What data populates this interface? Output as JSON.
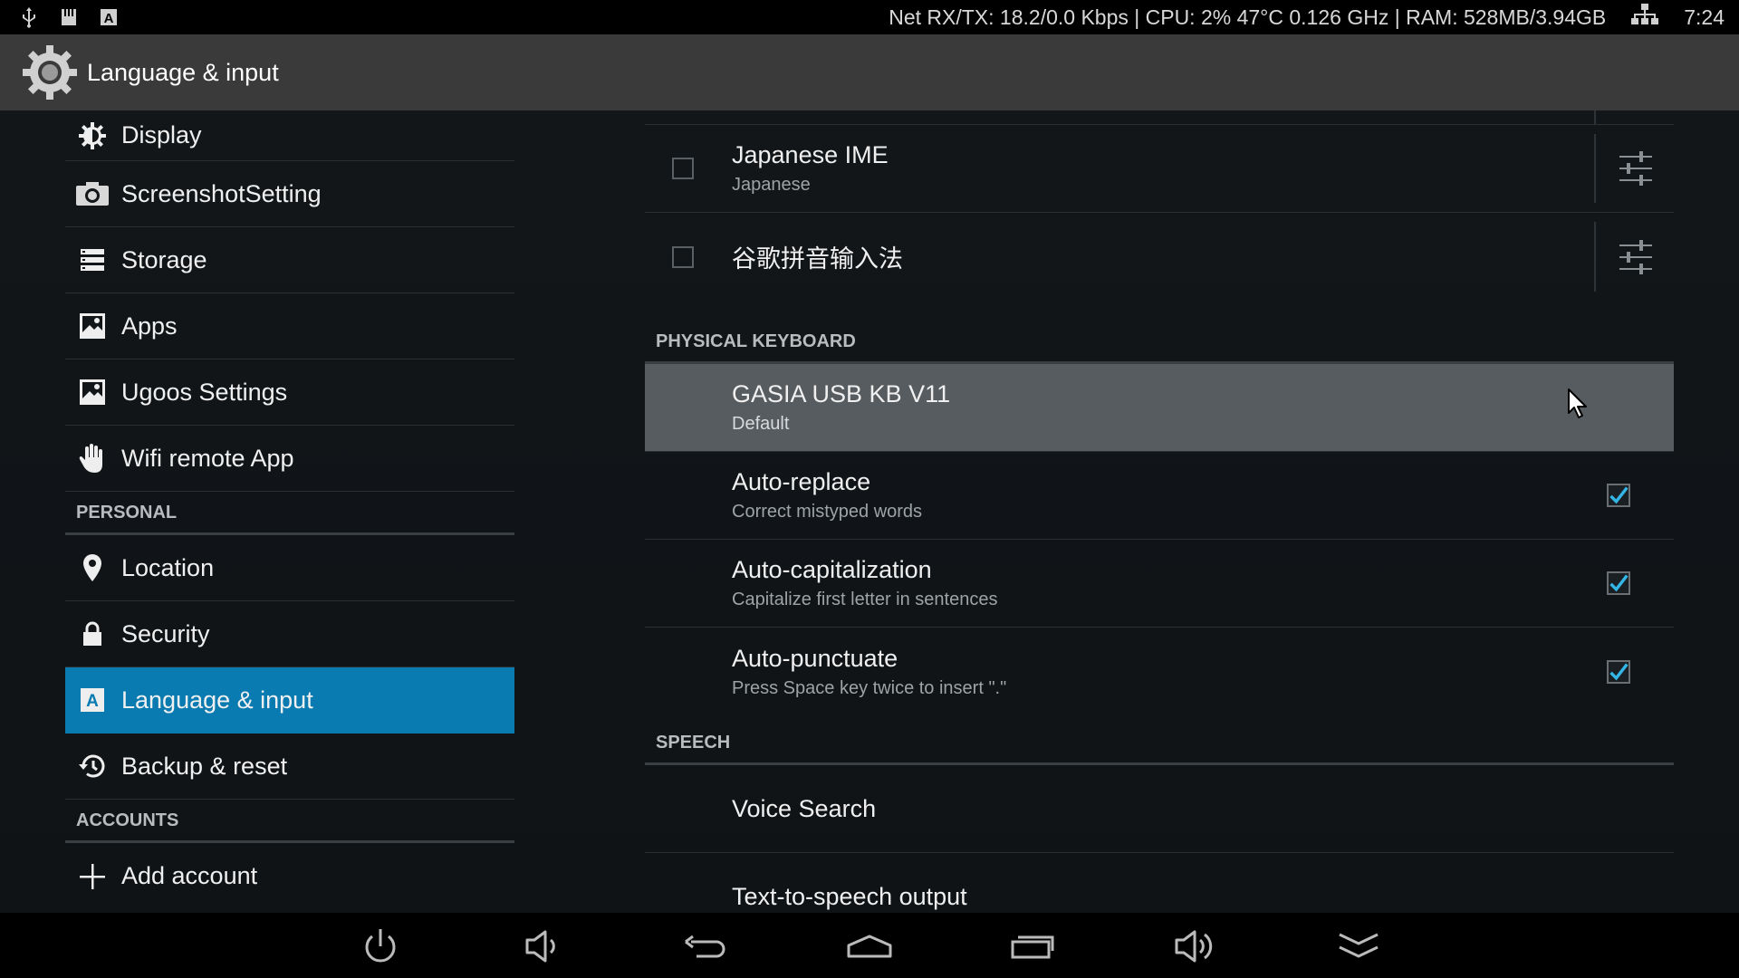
{
  "status_bar": {
    "net_stats": "Net RX/TX: 18.2/0.0 Kbps | CPU:  2%  47°C 0.126 GHz | RAM: 528MB/3.94GB",
    "time": "7:24",
    "left_icons": [
      "usb-icon",
      "sd-card-icon",
      "keyboard-a-icon"
    ],
    "right_icons": [
      "ethernet-icon"
    ]
  },
  "action_bar": {
    "title": "Language & input",
    "icon": "settings-gear-icon"
  },
  "left_nav": {
    "items_top": [
      {
        "label": "Display",
        "icon": "display-brightness-icon"
      },
      {
        "label": "ScreenshotSetting",
        "icon": "camera-icon"
      },
      {
        "label": "Storage",
        "icon": "storage-icon"
      },
      {
        "label": "Apps",
        "icon": "apps-icon"
      },
      {
        "label": "Ugoos Settings",
        "icon": "apps-icon"
      },
      {
        "label": "Wifi remote App",
        "icon": "hand-icon"
      }
    ],
    "personal_header": "PERSONAL",
    "items_personal": [
      {
        "label": "Location",
        "icon": "location-pin-icon"
      },
      {
        "label": "Security",
        "icon": "lock-icon"
      },
      {
        "label": "Language & input",
        "icon": "keyboard-a-icon",
        "selected": true
      },
      {
        "label": "Backup & reset",
        "icon": "backup-restore-icon"
      }
    ],
    "accounts_header": "ACCOUNTS",
    "items_accounts": [
      {
        "label": "Add account",
        "icon": "plus-icon"
      }
    ]
  },
  "right_pane": {
    "ime_items": [
      {
        "title": "Japanese IME",
        "subtitle": "Japanese",
        "checked": false
      },
      {
        "title": "谷歌拼音输入法",
        "subtitle": "",
        "checked": false
      }
    ],
    "physical_keyboard_header": "PHYSICAL KEYBOARD",
    "keyboard_device": {
      "title": "GASIA USB KB V11",
      "subtitle": "Default"
    },
    "keyboard_options": [
      {
        "title": "Auto-replace",
        "subtitle": "Correct mistyped words",
        "checked": true
      },
      {
        "title": "Auto-capitalization",
        "subtitle": "Capitalize first letter in sentences",
        "checked": true
      },
      {
        "title": "Auto-punctuate",
        "subtitle": "Press Space key twice to insert \".\"",
        "checked": true
      }
    ],
    "speech_header": "SPEECH",
    "speech_items": [
      {
        "title": "Voice Search"
      },
      {
        "title": "Text-to-speech output"
      }
    ]
  },
  "nav_bar": {
    "buttons": [
      "power-icon",
      "volume-down-icon",
      "back-icon",
      "home-icon",
      "recents-icon",
      "volume-up-icon",
      "hide-bar-icon"
    ]
  },
  "colors": {
    "accent": "#0a7bb0",
    "check": "#33b5e5",
    "highlight_row": "#575c60"
  }
}
